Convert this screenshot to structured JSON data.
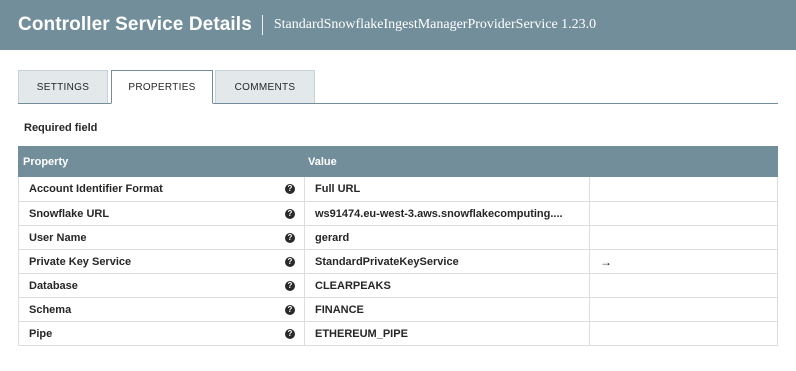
{
  "header": {
    "title": "Controller Service Details",
    "subtitle": "StandardSnowflakeIngestManagerProviderService 1.23.0"
  },
  "tabs": [
    {
      "label": "SETTINGS",
      "active": false
    },
    {
      "label": "PROPERTIES",
      "active": true
    },
    {
      "label": "COMMENTS",
      "active": false
    }
  ],
  "required_label": "Required field",
  "table": {
    "columns": [
      "Property",
      "Value"
    ],
    "rows": [
      {
        "property": "Account Identifier Format",
        "value": "Full URL",
        "action": ""
      },
      {
        "property": "Snowflake URL",
        "value": "ws91474.eu-west-3.aws.snowflakecomputing....",
        "action": ""
      },
      {
        "property": "User Name",
        "value": "gerard",
        "action": ""
      },
      {
        "property": "Private Key Service",
        "value": "StandardPrivateKeyService",
        "action": "→"
      },
      {
        "property": "Database",
        "value": "CLEARPEAKS",
        "action": ""
      },
      {
        "property": "Schema",
        "value": "FINANCE",
        "action": ""
      },
      {
        "property": "Pipe",
        "value": "ETHEREUM_PIPE",
        "action": ""
      }
    ]
  },
  "icons": {
    "help": "help-icon",
    "goto": "arrow-right-icon"
  },
  "colors": {
    "header_bg": "#728e9b",
    "tab_inactive_bg": "#e3e8eb"
  }
}
